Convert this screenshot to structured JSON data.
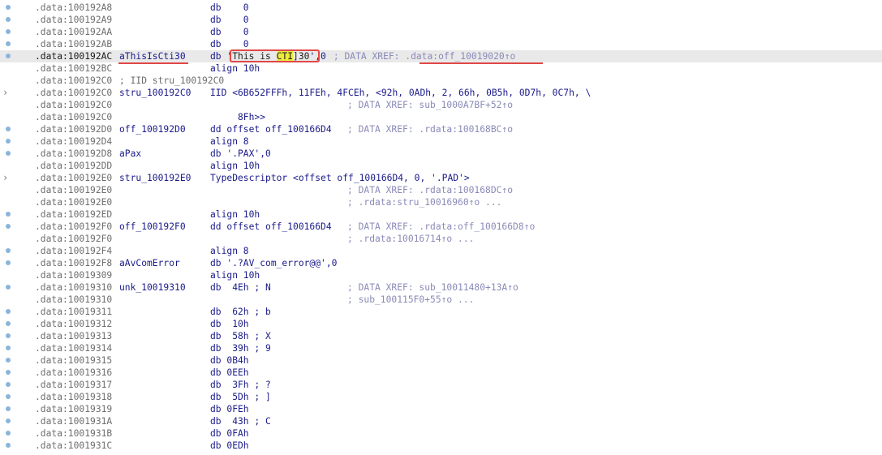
{
  "listing": [
    {
      "addr": ".data:100192A8",
      "label": "",
      "ins": "db    0",
      "comment": "",
      "mark": true
    },
    {
      "addr": ".data:100192A9",
      "label": "",
      "ins": "db    0",
      "comment": "",
      "mark": true
    },
    {
      "addr": ".data:100192AA",
      "label": "",
      "ins": "db    0",
      "comment": "",
      "mark": true
    },
    {
      "addr": ".data:100192AB",
      "label": "",
      "ins": "db    0",
      "comment": "",
      "mark": true
    },
    {
      "addr": ".data:100192AC",
      "label": "aThisIsCti30",
      "ins": "db 'This is CTI]30',0",
      "comment": "; DATA XREF: .data:off_10019020↑o",
      "mark": true,
      "current": true
    },
    {
      "addr": ".data:100192BC",
      "label": "",
      "ins": "align 10h",
      "comment": "",
      "mark": false
    },
    {
      "addr": ".data:100192C0",
      "label": "; IID stru_100192C0",
      "ins": "",
      "comment": "",
      "mark": false,
      "iid": true
    },
    {
      "addr": ".data:100192C0",
      "label": "stru_100192C0",
      "ins": "IID <6B652FFFh, 11FEh, 4FCEh, <92h, 0ADh, 2, 66h, 0B5h, 0D7h, 0C7h, \\",
      "comment": "",
      "mark": false,
      "chevron": true
    },
    {
      "addr": ".data:100192C0",
      "label": "",
      "ins": "",
      "comment": "; DATA XREF: sub_1000A7BF+52↑o",
      "mark": false
    },
    {
      "addr": ".data:100192C0",
      "label": "",
      "ins": "     8Fh>>",
      "comment": "",
      "mark": false
    },
    {
      "addr": ".data:100192D0",
      "label": "off_100192D0",
      "ins": "dd offset off_100166D4",
      "comment": "; DATA XREF: .rdata:100168BC↑o",
      "mark": true
    },
    {
      "addr": ".data:100192D4",
      "label": "",
      "ins": "align 8",
      "comment": "",
      "mark": true
    },
    {
      "addr": ".data:100192D8",
      "label": "aPax",
      "ins": "db '.PAX',0",
      "comment": "",
      "mark": true
    },
    {
      "addr": ".data:100192DD",
      "label": "",
      "ins": "align 10h",
      "comment": "",
      "mark": false
    },
    {
      "addr": ".data:100192E0",
      "label": "stru_100192E0",
      "ins": "TypeDescriptor <offset off_100166D4, 0, '.PAD'>",
      "comment": "",
      "mark": false,
      "chevron": true
    },
    {
      "addr": ".data:100192E0",
      "label": "",
      "ins": "",
      "comment": "; DATA XREF: .rdata:100168DC↑o",
      "mark": false
    },
    {
      "addr": ".data:100192E0",
      "label": "",
      "ins": "",
      "comment": "; .rdata:stru_10016960↑o ...",
      "mark": false
    },
    {
      "addr": ".data:100192ED",
      "label": "",
      "ins": "align 10h",
      "comment": "",
      "mark": true
    },
    {
      "addr": ".data:100192F0",
      "label": "off_100192F0",
      "ins": "dd offset off_100166D4",
      "comment": "; DATA XREF: .rdata:off_100166D8↑o",
      "mark": true
    },
    {
      "addr": ".data:100192F0",
      "label": "",
      "ins": "",
      "comment": "; .rdata:10016714↑o ...",
      "mark": false
    },
    {
      "addr": ".data:100192F4",
      "label": "",
      "ins": "align 8",
      "comment": "",
      "mark": true
    },
    {
      "addr": ".data:100192F8",
      "label": "aAvComError",
      "ins": "db '.?AV_com_error@@',0",
      "comment": "",
      "mark": true
    },
    {
      "addr": ".data:10019309",
      "label": "",
      "ins": "align 10h",
      "comment": "",
      "mark": false
    },
    {
      "addr": ".data:10019310",
      "label": "unk_10019310",
      "ins": "db  4Eh ; N",
      "comment": "; DATA XREF: sub_10011480+13A↑o",
      "mark": true
    },
    {
      "addr": ".data:10019310",
      "label": "",
      "ins": "",
      "comment": "; sub_100115F0+55↑o ...",
      "mark": false
    },
    {
      "addr": ".data:10019311",
      "label": "",
      "ins": "db  62h ; b",
      "comment": "",
      "mark": true
    },
    {
      "addr": ".data:10019312",
      "label": "",
      "ins": "db  10h",
      "comment": "",
      "mark": true
    },
    {
      "addr": ".data:10019313",
      "label": "",
      "ins": "db  58h ; X",
      "comment": "",
      "mark": true
    },
    {
      "addr": ".data:10019314",
      "label": "",
      "ins": "db  39h ; 9",
      "comment": "",
      "mark": true
    },
    {
      "addr": ".data:10019315",
      "label": "",
      "ins": "db 0B4h",
      "comment": "",
      "mark": true
    },
    {
      "addr": ".data:10019316",
      "label": "",
      "ins": "db 0EEh",
      "comment": "",
      "mark": true
    },
    {
      "addr": ".data:10019317",
      "label": "",
      "ins": "db  3Fh ; ?",
      "comment": "",
      "mark": true
    },
    {
      "addr": ".data:10019318",
      "label": "",
      "ins": "db  5Dh ; ]",
      "comment": "",
      "mark": true
    },
    {
      "addr": ".data:10019319",
      "label": "",
      "ins": "db 0FEh",
      "comment": "",
      "mark": true
    },
    {
      "addr": ".data:1001931A",
      "label": "",
      "ins": "db  43h ; C",
      "comment": "",
      "mark": true
    },
    {
      "addr": ".data:1001931B",
      "label": "",
      "ins": "db 0FAh",
      "comment": "",
      "mark": true
    },
    {
      "addr": ".data:1001931C",
      "label": "",
      "ins": "db 0EDh",
      "comment": "",
      "mark": true
    }
  ],
  "current_line": {
    "addr": ".data:100192AC",
    "label": "aThisIsCti30",
    "ins_prefix": "db '",
    "str_pre": "This is ",
    "str_hl": "CTI",
    "str_post": "]30",
    "ins_suffix": "',0",
    "comment_prefix": "; DATA XREF: ",
    "comment_ref": ".data:off_10019020↑o"
  },
  "colors": {
    "annotation_red": "#e04848",
    "highlight_yellow": "#ecec3a",
    "current_line_bg": "#e9e9e9",
    "breakpoint_marker": "#8ab4dc"
  }
}
